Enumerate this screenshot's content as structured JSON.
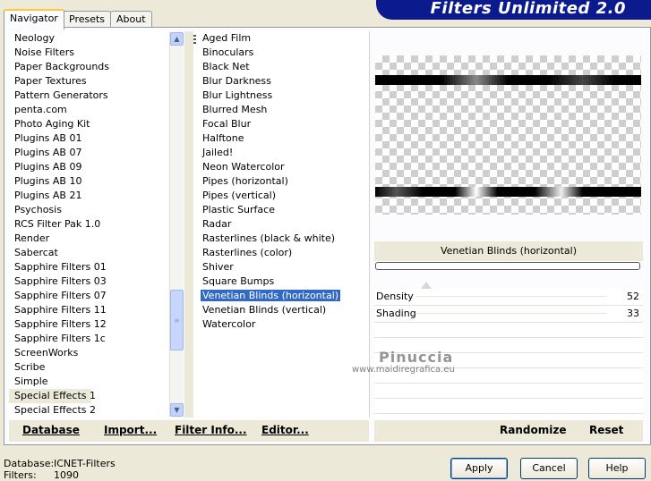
{
  "banner": {
    "title": "Filters Unlimited 2.0"
  },
  "tabs": [
    {
      "label": "Navigator"
    },
    {
      "label": "Presets"
    },
    {
      "label": "About"
    }
  ],
  "categories": [
    "Neology",
    "Noise Filters",
    "Paper Backgrounds",
    "Paper Textures",
    "Pattern Generators",
    "penta.com",
    "Photo Aging Kit",
    "Plugins AB 01",
    "Plugins AB 07",
    "Plugins AB 09",
    "Plugins AB 10",
    "Plugins AB 21",
    "Psychosis",
    "RCS Filter Pak 1.0",
    "Render",
    "Sabercat",
    "Sapphire Filters 01",
    "Sapphire Filters 03",
    "Sapphire Filters 07",
    "Sapphire Filters 11",
    "Sapphire Filters 12",
    "Sapphire Filters 1c",
    "ScreenWorks",
    "Scribe",
    "Simple",
    "Special Effects 1",
    "Special Effects 2"
  ],
  "selected_category": "Special Effects 1",
  "filters": [
    "Aged Film",
    "Binoculars",
    "Black Net",
    "Blur Darkness",
    "Blur Lightness",
    "Blurred Mesh",
    "Focal Blur",
    "Halftone",
    "Jailed!",
    "Neon Watercolor",
    "Pipes (horizontal)",
    "Pipes (vertical)",
    "Plastic Surface",
    "Radar",
    "Rasterlines (black & white)",
    "Rasterlines (color)",
    "Shiver",
    "Square Bumps",
    "Venetian Blinds (horizontal)",
    "Venetian Blinds (vertical)",
    "Watercolor"
  ],
  "selected_filter": "Venetian Blinds (horizontal)",
  "filter_name": "Venetian Blinds (horizontal)",
  "controls": [
    {
      "label": "Density",
      "value": "52"
    },
    {
      "label": "Shading",
      "value": "33"
    }
  ],
  "watermark": {
    "name": "Pinuccia",
    "url": "www.maidiregrafica.eu"
  },
  "left_actions": {
    "database": "Database",
    "import": "Import...",
    "filter_info": "Filter Info...",
    "editor": "Editor..."
  },
  "right_actions": {
    "randomize": "Randomize",
    "reset": "Reset"
  },
  "info": {
    "database_label": "Database:",
    "database_value": "ICNET-Filters",
    "filters_label": "Filters:",
    "filters_value": "1090"
  },
  "buttons": {
    "apply": "Apply",
    "cancel": "Cancel",
    "help": "Help"
  },
  "colors": {
    "banner": "#0b1a8c",
    "selection": "#316ac5",
    "dialog_bg": "#ece9d8"
  }
}
